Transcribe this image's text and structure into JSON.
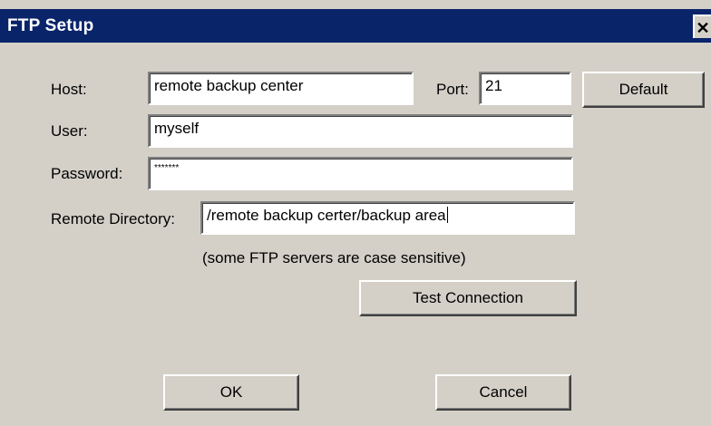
{
  "dialog": {
    "title": "FTP Setup",
    "close_glyph": "✕"
  },
  "form": {
    "host_label": "Host:",
    "host_value": "remote backup center",
    "port_label": "Port:",
    "port_value": "21",
    "default_button": "Default",
    "user_label": "User:",
    "user_value": "myself",
    "password_label": "Password:",
    "password_value": "*******",
    "remote_dir_label": "Remote Directory:",
    "remote_dir_value": "/remote backup certer/backup area",
    "case_note": "(some FTP servers are case sensitive)",
    "test_button": "Test Connection"
  },
  "footer": {
    "ok_button": "OK",
    "cancel_button": "Cancel"
  },
  "colors": {
    "titlebar": "#0a246a",
    "face": "#d4d0c8",
    "field": "#ffffff"
  }
}
